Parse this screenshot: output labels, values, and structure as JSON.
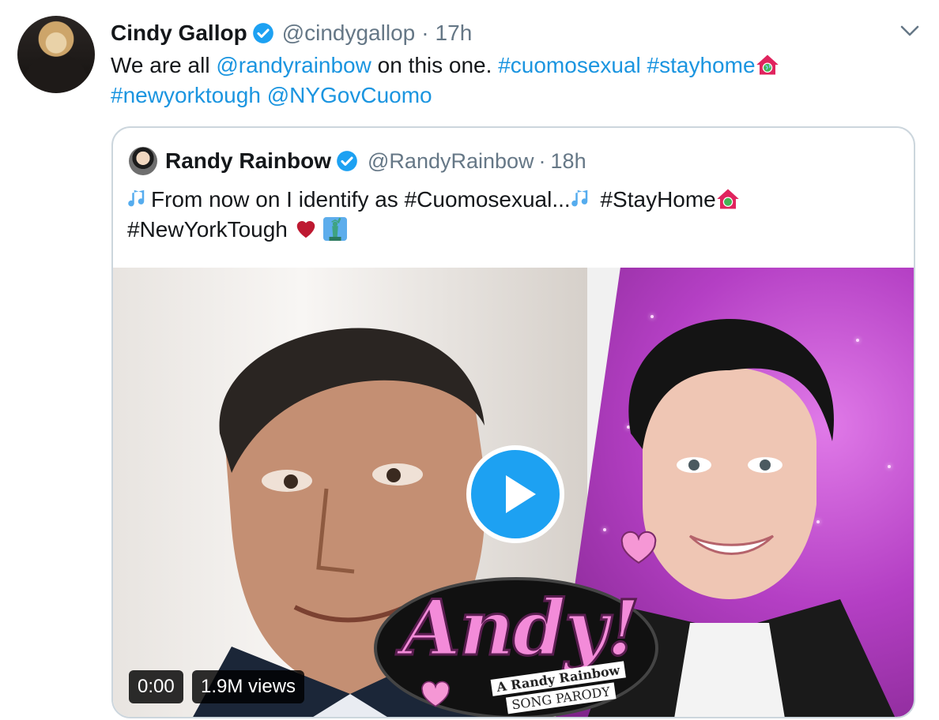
{
  "tweet": {
    "author_name": "Cindy Gallop",
    "handle": "@cindygallop",
    "separator": "·",
    "time": "17h",
    "text_parts": {
      "p1": "We are all ",
      "mention1": "@randyrainbow",
      "p2": " on this one. ",
      "tag1": "#cuomosexual",
      "p3": " ",
      "tag2": "#stayhome",
      "tag3": "#newyorktough",
      "p4": " ",
      "mention2": "@NYGovCuomo"
    }
  },
  "quoted": {
    "author_name": "Randy Rainbow",
    "handle": "@RandyRainbow",
    "separator": "·",
    "time": "18h",
    "text_parts": {
      "p1": "From now on I identify as #Cuomosexual...",
      "p2": " #StayHome",
      "p3": "#NewYorkTough "
    }
  },
  "media": {
    "logo_title": "Andy!",
    "logo_sub1": "A Randy Rainbow",
    "logo_sub2": "SONG PARODY",
    "duration": "0:00",
    "views": "1.9M views"
  },
  "icons": {
    "verified": "verified-badge-icon",
    "chevron": "chevron-down-icon",
    "music_notes": "musical-notes-emoji",
    "house_earth": "house-with-earth-emoji",
    "red_heart": "red-heart-emoji",
    "liberty": "statue-of-liberty-emoji",
    "play": "play-icon"
  },
  "colors": {
    "link": "#1b95e0",
    "secondary_text": "#657786",
    "play_button": "#1da1f2",
    "border": "#ccd6dd"
  }
}
